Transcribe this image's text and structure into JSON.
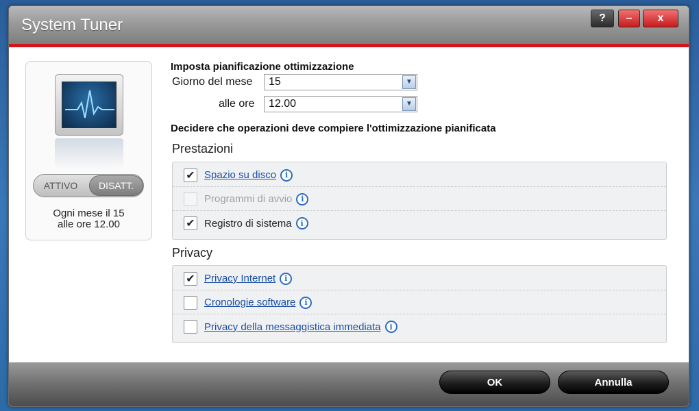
{
  "window": {
    "title": "System Tuner"
  },
  "titlebar_buttons": {
    "help": "?",
    "minimize": "–",
    "close": "x"
  },
  "left_panel": {
    "toggle_on": "ATTIVO",
    "toggle_off": "DISATT.",
    "schedule_line1": "Ogni mese il 15",
    "schedule_line2": "alle ore 12.00",
    "icon": "heartbeat-monitor-icon"
  },
  "schedule": {
    "heading": "Imposta pianificazione ottimizzazione",
    "day_label": "Giorno del mese",
    "day_value": "15",
    "time_label": "alle ore",
    "time_value": "12.00"
  },
  "operations_heading": "Decidere che operazioni deve compiere l'ottimizzazione pianificata",
  "prestazioni": {
    "title": "Prestazioni",
    "items": [
      {
        "label": "Spazio su disco",
        "checked": true,
        "enabled": true,
        "link": true
      },
      {
        "label": "Programmi di avvio",
        "checked": false,
        "enabled": false,
        "link": false
      },
      {
        "label": "Registro di sistema",
        "checked": true,
        "enabled": true,
        "link": false
      }
    ]
  },
  "privacy": {
    "title": "Privacy",
    "items": [
      {
        "label": "Privacy Internet",
        "checked": true,
        "enabled": true,
        "link": true
      },
      {
        "label": "Cronologie software",
        "checked": false,
        "enabled": true,
        "link": true
      },
      {
        "label": "Privacy della messaggistica immediata",
        "checked": false,
        "enabled": true,
        "link": true
      }
    ]
  },
  "footer": {
    "ok_label": "OK",
    "cancel_label": "Annulla"
  },
  "colors": {
    "accent_red": "#d4141a",
    "link_blue": "#1a4fa3"
  }
}
